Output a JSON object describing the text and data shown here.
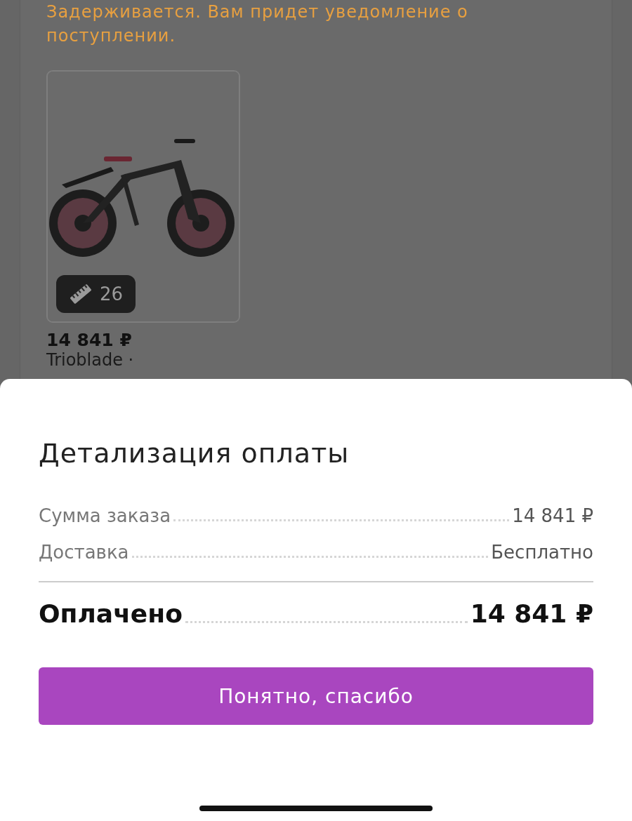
{
  "order": {
    "status_note": "Задерживается. Вам придет уведомление о поступлении.",
    "product": {
      "size_badge": "26",
      "price": "14 841 ₽",
      "name": "Trioblade ·"
    }
  },
  "sheet": {
    "title": "Детализация оплаты",
    "rows": [
      {
        "label": "Сумма заказа",
        "value": "14 841 ₽"
      },
      {
        "label": "Доставка",
        "value": "Бесплатно"
      }
    ],
    "total": {
      "label": "Оплачено",
      "value": "14 841 ₽"
    },
    "button": "Понятно, спасибо"
  }
}
